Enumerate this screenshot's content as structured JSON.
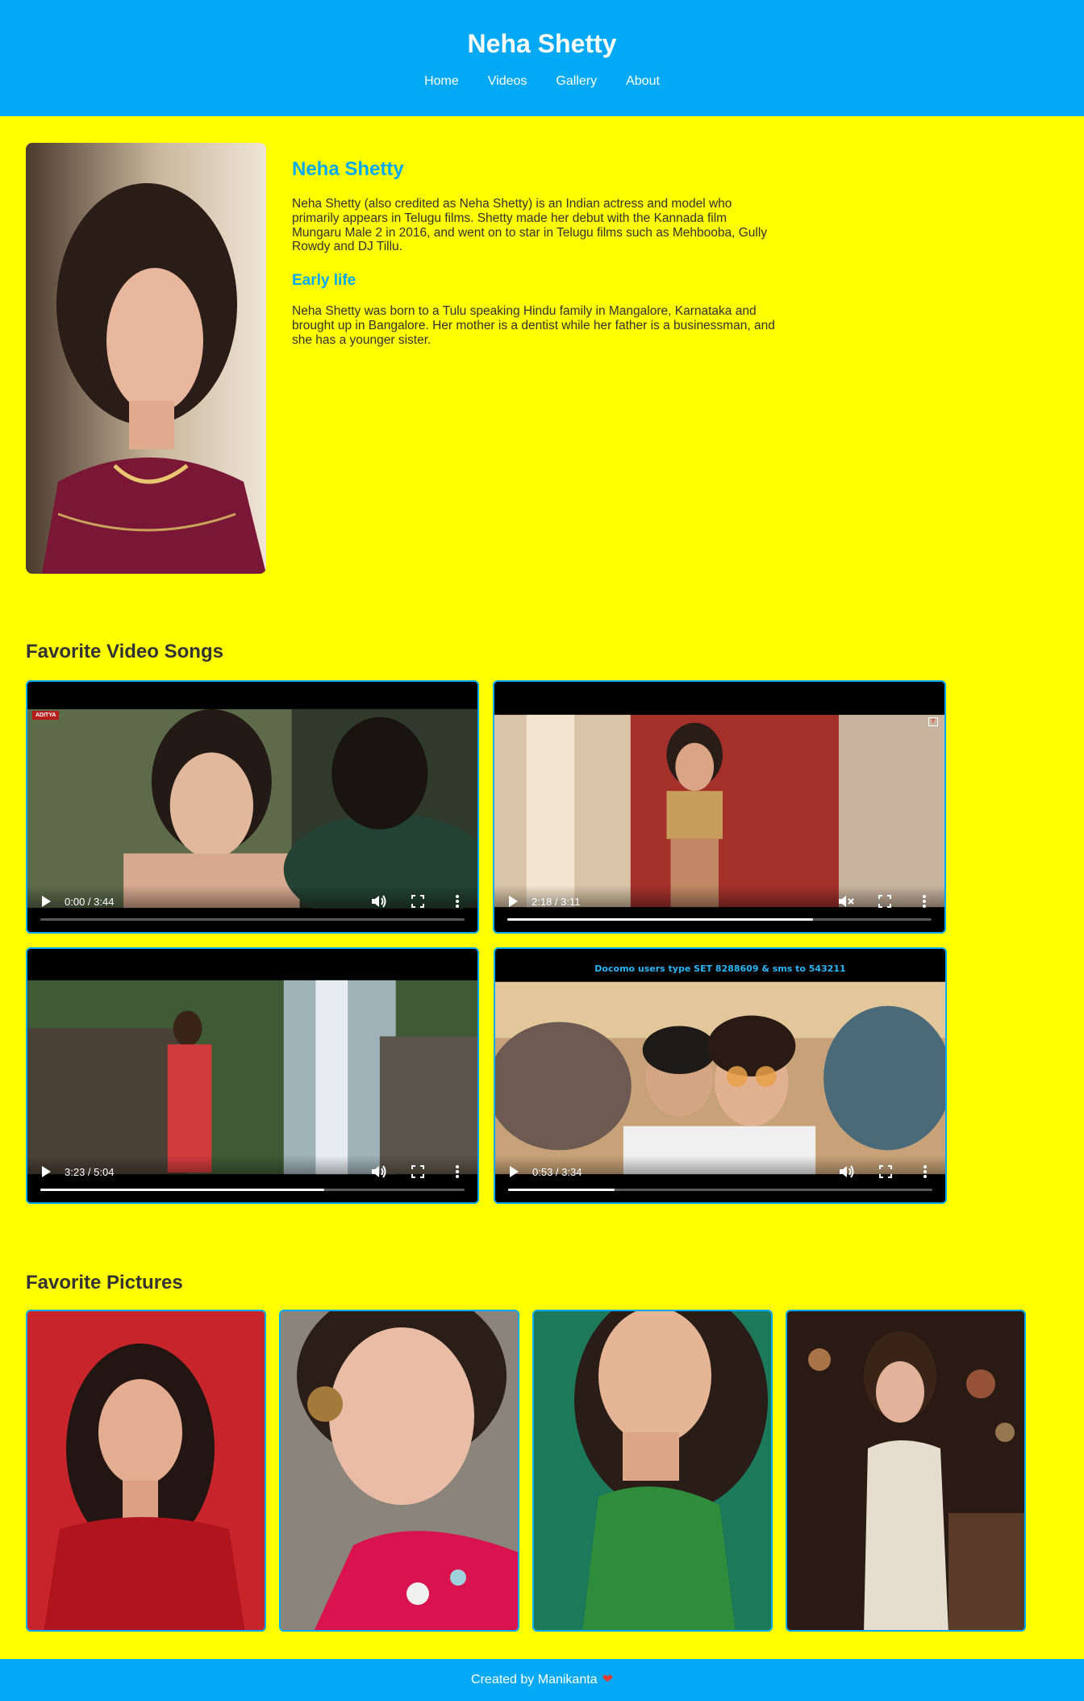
{
  "header": {
    "title": "Neha Shetty",
    "nav": [
      "Home",
      "Videos",
      "Gallery",
      "About"
    ]
  },
  "profile": {
    "name": "Neha Shetty",
    "intro": "Neha Shetty (also credited as Neha Shetty) is an Indian actress and model who primarily appears in Telugu films. Shetty made her debut with the Kannada film Mungaru Male 2 in 2016, and went on to star in Telugu films such as Mehbooba, Gully Rowdy and DJ Tillu.",
    "early_life_heading": "Early life",
    "early_life": "Neha Shetty was born to a Tulu speaking Hindu family in Mangalore, Karnataka and brought up in Bangalore. Her mother is a dentist while her father is a businessman, and she has a younger sister."
  },
  "videos": {
    "heading": "Favorite Video Songs",
    "items": [
      {
        "time": "0:00 / 3:44",
        "progress": 0.0,
        "muted": false,
        "logo": "ADITYA"
      },
      {
        "time": "2:18 / 3:11",
        "progress": 0.72,
        "muted": true,
        "logo": "T"
      },
      {
        "time": "3:23 / 5:04",
        "progress": 0.67,
        "muted": false,
        "logo": ""
      },
      {
        "time": "0:53 / 3:34",
        "progress": 0.25,
        "muted": false,
        "overlay": "Docomo users type SET 8288609 & sms to 543211"
      }
    ]
  },
  "pictures": {
    "heading": "Favorite Pictures"
  },
  "footer": {
    "text": "Created by Manikanta",
    "heart": "❤"
  },
  "colors": {
    "primary": "#03a9f4",
    "background": "#ffff00",
    "text": "#333333"
  }
}
